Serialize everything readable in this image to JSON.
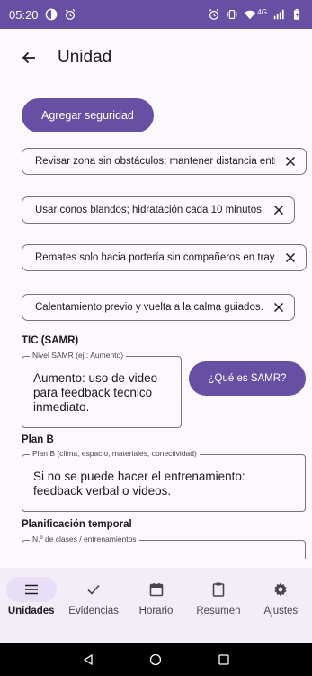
{
  "status_bar": {
    "time": "05:20",
    "network": "4G",
    "icons": [
      "circle-half-icon",
      "alarm-icon",
      "alarm-icon",
      "vibrate-icon",
      "wifi-icon",
      "signal-icon",
      "battery-icon"
    ]
  },
  "app_bar": {
    "title": "Unidad",
    "back_icon": "arrow-left-icon"
  },
  "actions": {
    "add_safety_label": "Agregar seguridad"
  },
  "safety_items": [
    "Revisar zona sin obstáculos; mantener distancia entre",
    "Usar conos blandos; hidratación cada 10 minutos.",
    "Remates solo hacia portería sin compañeros en trayecto",
    "Calentamiento previo y vuelta a la calma guiados."
  ],
  "tic": {
    "section_label": "TIC (SAMR)",
    "field_label": "Nivel SAMR (ej.: Aumento)",
    "value": "Aumento: uso de video\npara feedback técnico\ninmediato.",
    "help_button": "¿Qué es SAMR?"
  },
  "plan_b": {
    "section_label": "Plan B",
    "field_label": "Plan B (clima, espacio, materiales, conectividad)",
    "value": "Si no se puede hacer el entrenamiento:\nfeedback verbal o videos."
  },
  "planning": {
    "section_label": "Planificación temporal",
    "field_label": "N.º de clases / entrenamientos",
    "value": ""
  },
  "bottom_nav": [
    {
      "label": "Unidades",
      "icon": "menu-icon",
      "active": true
    },
    {
      "label": "Evidencias",
      "icon": "check-icon",
      "active": false
    },
    {
      "label": "Horario",
      "icon": "calendar-icon",
      "active": false
    },
    {
      "label": "Resumen",
      "icon": "clipboard-icon",
      "active": false
    },
    {
      "label": "Ajustes",
      "icon": "gear-icon",
      "active": false
    }
  ],
  "colors": {
    "primary": "#6750a4",
    "surface": "#fdf8fd",
    "nav_surface": "#f3edf7",
    "active_indicator": "#e8def8",
    "outline": "#79747e"
  }
}
